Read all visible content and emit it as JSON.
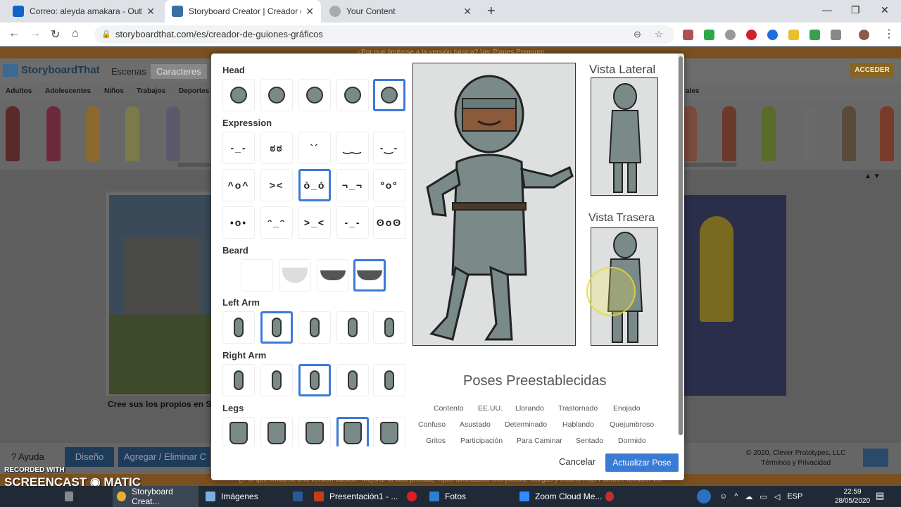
{
  "browser": {
    "tabs": [
      {
        "title": "Correo: aleyda amakara - Outloo",
        "favicon_color": "#0f64c8"
      },
      {
        "title": "Storyboard Creator | Creador de",
        "favicon_color": "#3a6ea5"
      },
      {
        "title": "Your Content",
        "favicon_color": "#aaaaaa"
      }
    ],
    "new_tab": "+",
    "minimize": "—",
    "maximize": "❐",
    "close": "✕",
    "back": "←",
    "forward": "→",
    "reload": "↻",
    "home": "⌂",
    "url": "storyboardthat.com/es/creador-de-guiones-gráficos",
    "zoom_icon": "⊖",
    "star_icon": "☆"
  },
  "site": {
    "banner": "¿Por qué limitarse a la versión básica? Ver Planes Premium",
    "logo": "StoryboardThat",
    "tabs": [
      "Escenas",
      "Caracteres"
    ],
    "acceder": "ACCEDER",
    "categories": [
      "Adultos",
      "Adolescentes",
      "Niños",
      "Trabajos",
      "Deportes"
    ],
    "category_right": "ales",
    "create_label": "Cree sus los propios en S",
    "arrows": "▲ ▼",
    "footer": {
      "ayuda": "? Ayuda",
      "diseno": "Diseño",
      "agregar": "Agregar / Eliminar C",
      "copyright": "© 2020, Clever Prototypes, LLC",
      "terms": "Términos y Privacidad"
    },
    "footer_banner": "¿Por qué limitarse a la versión básica? Mejorar la vida privada, Tipos avanzados Storyboard, Cargas y mucho más Planes Premium Ver"
  },
  "screencast": {
    "recorded": "RECORDED WITH",
    "brand": "SCREENCAST ◉ MATIC"
  },
  "modal": {
    "sections": {
      "head": "Head",
      "expression": "Expression",
      "beard": "Beard",
      "left_arm": "Left Arm",
      "right_arm": "Right Arm",
      "legs": "Legs"
    },
    "head_selected": 4,
    "expression_faces": [
      "-_-",
      "ಠಠ",
      "`´",
      "‿‿",
      "-‿-",
      "^o^",
      "><",
      "ò_ó",
      "¬_¬",
      "ºoº",
      "•o•",
      "ᵔ_ᵔ",
      ">_<",
      "-_-",
      "ʘoʘ"
    ],
    "expression_selected": 7,
    "beard_selected": 3,
    "left_arm_selected": 1,
    "right_arm_selected": 2,
    "legs_selected": 3,
    "vista_lateral": "Vista Lateral",
    "vista_trasera": "Vista Trasera",
    "poses_title": "Poses Preestablecidas",
    "poses": [
      [
        "Contento",
        "EE.UU.",
        "Llorando",
        "Trastornado",
        "Enojado"
      ],
      [
        "Confuso",
        "Asustado",
        "Determinado",
        "Hablando",
        "Quejumbroso"
      ],
      [
        "Gritos",
        "Participación",
        "Para Caminar",
        "Sentado",
        "Dormido"
      ]
    ],
    "cancel": "Cancelar",
    "update": "Actualizar Pose",
    "colors": {
      "armor": "#7a8a88",
      "skin": "#8a5a3a",
      "accent": "#3a7bd5"
    }
  },
  "taskbar": {
    "apps": [
      {
        "label": "Storyboard Creat...",
        "color": "#e8b030"
      },
      {
        "label": "Imágenes",
        "color": "#7ab0e0"
      },
      {
        "label": "W",
        "color": "#2b5797"
      },
      {
        "label": "Presentación1 - ...",
        "color": "#c43e1c"
      },
      {
        "label": "O",
        "color": "#e02020"
      },
      {
        "label": "Fotos",
        "color": "#2d7fd3"
      },
      {
        "label": "Zoom Cloud Me...",
        "color": "#2d8cff"
      }
    ],
    "lang": "ESP",
    "time": "22:59",
    "date": "28/05/2020"
  }
}
